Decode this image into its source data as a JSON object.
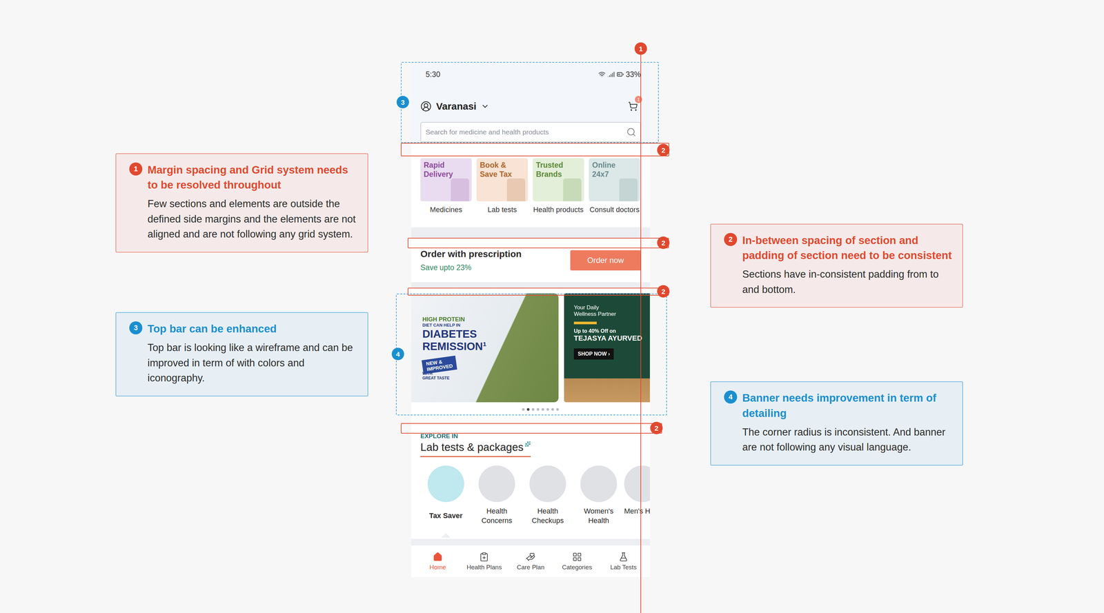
{
  "annotations": {
    "left": [
      {
        "number": "1",
        "color": "#e0492f",
        "title": "Margin spacing and Grid system needs to be resolved throughout",
        "body": "Few sections and elements are outside the defined side margins and the elements are not aligned and are not following any grid system."
      },
      {
        "number": "3",
        "color": "#1a8fd0",
        "title": "Top bar can be enhanced",
        "body": "Top bar is looking like a wireframe and can be improved in term of with colors and iconography."
      }
    ],
    "right": [
      {
        "number": "2",
        "color": "#e0492f",
        "title": "In-between spacing of section and padding of section need to be consistent",
        "body": "Sections have in-consistent padding from to and bottom."
      },
      {
        "number": "4",
        "color": "#1a8fd0",
        "title": "Banner needs improvement in term of detailing",
        "body": "The corner radius is inconsistent. And banner are not following any visual language."
      }
    ]
  },
  "markers": [
    {
      "number": "1",
      "color": "#e0492f"
    },
    {
      "number": "2",
      "color": "#e0492f"
    },
    {
      "number": "2",
      "color": "#e0492f"
    },
    {
      "number": "2",
      "color": "#e0492f"
    },
    {
      "number": "2",
      "color": "#e0492f"
    },
    {
      "number": "3",
      "color": "#1a8fd0"
    },
    {
      "number": "4",
      "color": "#1a8fd0"
    }
  ],
  "phone": {
    "status_bar": {
      "time": "5:30",
      "battery": "33%"
    },
    "location": "Varanasi",
    "cart_badge": "1",
    "search": {
      "placeholder": "Search for medicine and health products"
    },
    "categories": [
      {
        "tag": "Rapid Delivery",
        "label": "Medicines",
        "color": "#eadcf0",
        "ink": "#8e4a9e"
      },
      {
        "tag": "Book & Save Tax",
        "label": "Lab tests",
        "color": "#f8e3d4",
        "ink": "#b0642c"
      },
      {
        "tag": "Trusted Brands",
        "label": "Health products",
        "color": "#e3efd9",
        "ink": "#5b8a36"
      },
      {
        "tag": "Online 24x7",
        "label": "Consult doctors",
        "color": "#dbe8e7",
        "ink": "#6a8a8d"
      }
    ],
    "prescription": {
      "title": "Order with prescription",
      "subtitle": "Save upto 23%",
      "button": "Order now"
    },
    "banners": [
      {
        "kind": "protein",
        "eyebrow": [
          "HIGH PROTEIN",
          "DIET CAN HELP IN"
        ],
        "headline": [
          "DIABETES",
          "REMISSION¹"
        ],
        "stamp": [
          "NEW &",
          "IMPROVED"
        ],
        "note": [
          "WITH",
          "GREAT TASTE"
        ]
      },
      {
        "kind": "wellness",
        "eyebrow": [
          "Your Daily",
          "Wellness Partner"
        ],
        "headline": [
          "Up to 40% Off on",
          "TEJASYA AYURVED"
        ],
        "stamp": [
          "SHOP NOW ›"
        ],
        "note": []
      }
    ],
    "carousel_dots": [
      {
        "selected": false
      },
      {
        "selected": true
      },
      {
        "selected": false
      },
      {
        "selected": false
      },
      {
        "selected": false
      },
      {
        "selected": false
      },
      {
        "selected": false
      },
      {
        "selected": false
      }
    ],
    "explore": {
      "eyebrow": "EXPLORE IN",
      "title": "Lab tests & packages",
      "items": [
        {
          "label": "Tax Saver",
          "selected": true
        },
        {
          "label": "Health Concerns",
          "selected": false
        },
        {
          "label": "Health Checkups",
          "selected": false
        },
        {
          "label": "Women's Health",
          "selected": false
        },
        {
          "label": "Men's H",
          "selected": false
        }
      ]
    },
    "nav": [
      {
        "label": "Home",
        "selected": true
      },
      {
        "label": "Health Plans",
        "selected": false
      },
      {
        "label": "Care Plan",
        "selected": false
      },
      {
        "label": "Categories",
        "selected": false
      },
      {
        "label": "Lab Tests",
        "selected": false
      }
    ]
  }
}
